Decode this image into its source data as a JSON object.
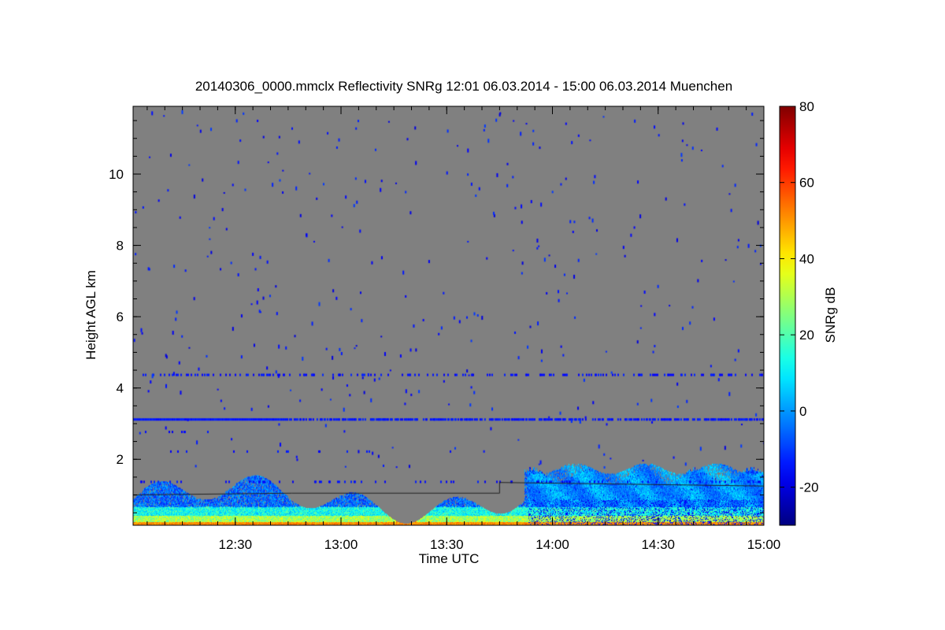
{
  "chart_data": {
    "type": "heatmap",
    "title": "20140306_0000.mmclx Reflectivity SNRg   12:01 06.03.2014 - 15:00 06.03.2014 Muenchen",
    "xlabel": "Time UTC",
    "ylabel": "Height AGL km",
    "colorbar_label": "SNRg dB",
    "x_range": [
      "12:01",
      "15:00"
    ],
    "y_range_km": [
      0.15,
      11.9
    ],
    "x_ticks": [
      "12:30",
      "13:00",
      "13:30",
      "14:00",
      "14:30",
      "15:00"
    ],
    "y_ticks": [
      2,
      4,
      6,
      8,
      10
    ],
    "colorbar_range_db": [
      -30,
      80
    ],
    "colorbar_ticks": [
      -20,
      0,
      20,
      40,
      60,
      80
    ],
    "colormap": "jet",
    "no_signal_color": "#808080",
    "features": [
      {
        "description_value": "low echo layer",
        "time": [
          "12:01",
          "15:00"
        ],
        "height_km": [
          0.15,
          1.7
        ],
        "snr_db": [
          -15,
          50
        ]
      },
      {
        "description_value": "deeper echo",
        "time": [
          "13:53",
          "15:00"
        ],
        "height_km": [
          0.15,
          1.95
        ],
        "snr_db": [
          -20,
          10
        ]
      },
      {
        "description_value": "echo line",
        "time": [
          "12:01",
          "12:45"
        ],
        "height_km": [
          3.15,
          3.15
        ],
        "snr_db": [
          -15,
          -15
        ]
      }
    ]
  }
}
